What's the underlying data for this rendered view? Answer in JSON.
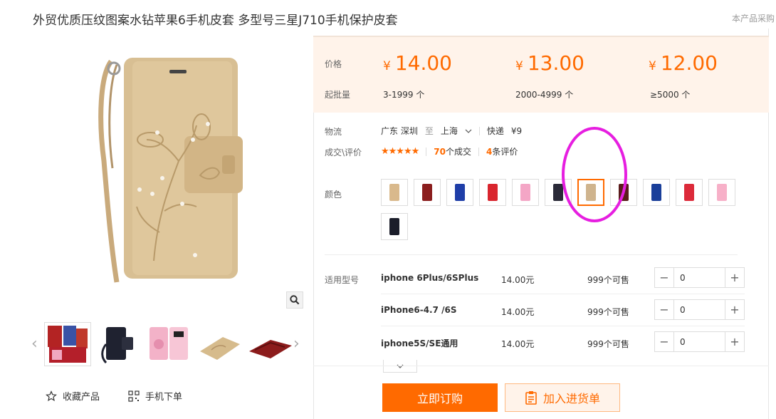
{
  "title": "外贸优质压纹图案水钻苹果6手机皮套 多型号三星J710手机保护皮套",
  "notice": "本产品采购",
  "price_label": "价格",
  "min_order_label": "起批量",
  "currency": "¥",
  "tiers": [
    {
      "price": "14.00",
      "range": "3-1999 个"
    },
    {
      "price": "13.00",
      "range": "2000-4999 个"
    },
    {
      "price": "12.00",
      "range": "≥5000 个"
    }
  ],
  "logistics": {
    "label": "物流",
    "from": "广东 深圳",
    "to_word": "至",
    "dest": "上海",
    "method": "快递",
    "fee": "¥9"
  },
  "deals": {
    "label": "成交\\评价",
    "stars": "★★★★★",
    "sold_count": "70",
    "sold_suffix": "个成交",
    "review_count": "4",
    "review_suffix": "条评价"
  },
  "color_label": "颜色",
  "swatches": [
    {
      "color": "#d9b98c"
    },
    {
      "color": "#8b1e1e"
    },
    {
      "color": "#1f3ea8"
    },
    {
      "color": "#d9252e"
    },
    {
      "color": "#f4a6c6"
    },
    {
      "color": "#2a2a38"
    },
    {
      "color": "#cfb48e"
    },
    {
      "color": "#5a1b1b"
    },
    {
      "color": "#1a3f9a"
    },
    {
      "color": "#dc2a3a"
    },
    {
      "color": "#f7b0c8"
    },
    {
      "color": "#1b1d2a"
    }
  ],
  "selected_swatch": 6,
  "model_label": "适用型号",
  "models": [
    {
      "name": "iphone 6Plus/6SPlus",
      "price": "14.00元",
      "avail": "999个可售",
      "qty": "0"
    },
    {
      "name": "iPhone6-4.7 /6S",
      "price": "14.00元",
      "avail": "999个可售",
      "qty": "0"
    },
    {
      "name": "iphone5S/SE通用",
      "price": "14.00元",
      "avail": "999个可售",
      "qty": "0"
    }
  ],
  "buttons": {
    "order": "立即订购",
    "cart": "加入进货单",
    "favorite": "收藏产品",
    "mobile": "手机下单"
  },
  "icons": {
    "zoom": "magnifier-icon",
    "star": "star-outline-icon",
    "qr": "qr-code-icon",
    "cart": "clipboard-list-icon",
    "chevron": "chevron-down-icon"
  },
  "colors": {
    "accent": "#ff6a00",
    "price_bg": "#fff3ea",
    "annotation": "#e61ee0"
  }
}
